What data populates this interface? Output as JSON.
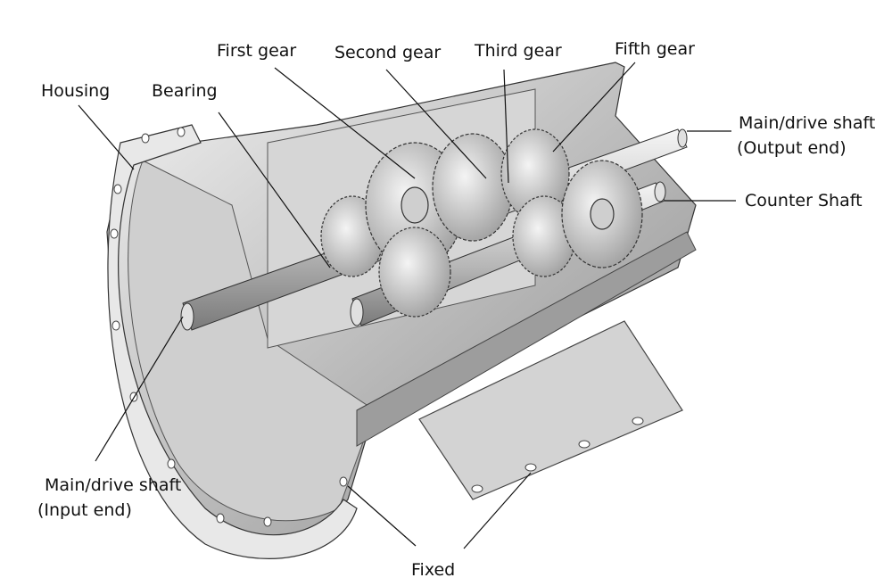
{
  "figure": {
    "subject": "Gearbox assembly cutaway",
    "labels": {
      "housing": "Housing",
      "bearing": "Bearing",
      "first_gear": "First gear",
      "second_gear": "Second gear",
      "third_gear": "Third gear",
      "fifth_gear": "Fifth gear",
      "output_shaft_line1": "Main/drive shaft",
      "output_shaft_line2": "(Output end)",
      "counter_shaft": "Counter Shaft",
      "input_shaft_line1": "Main/drive shaft",
      "input_shaft_line2": "(Input end)",
      "fixed": "Fixed"
    },
    "colors": {
      "metal_light": "#e6e6e6",
      "metal_mid": "#bdbdbd",
      "metal_dark": "#8a8a8a",
      "outline": "#333333",
      "leader": "#111111"
    }
  }
}
